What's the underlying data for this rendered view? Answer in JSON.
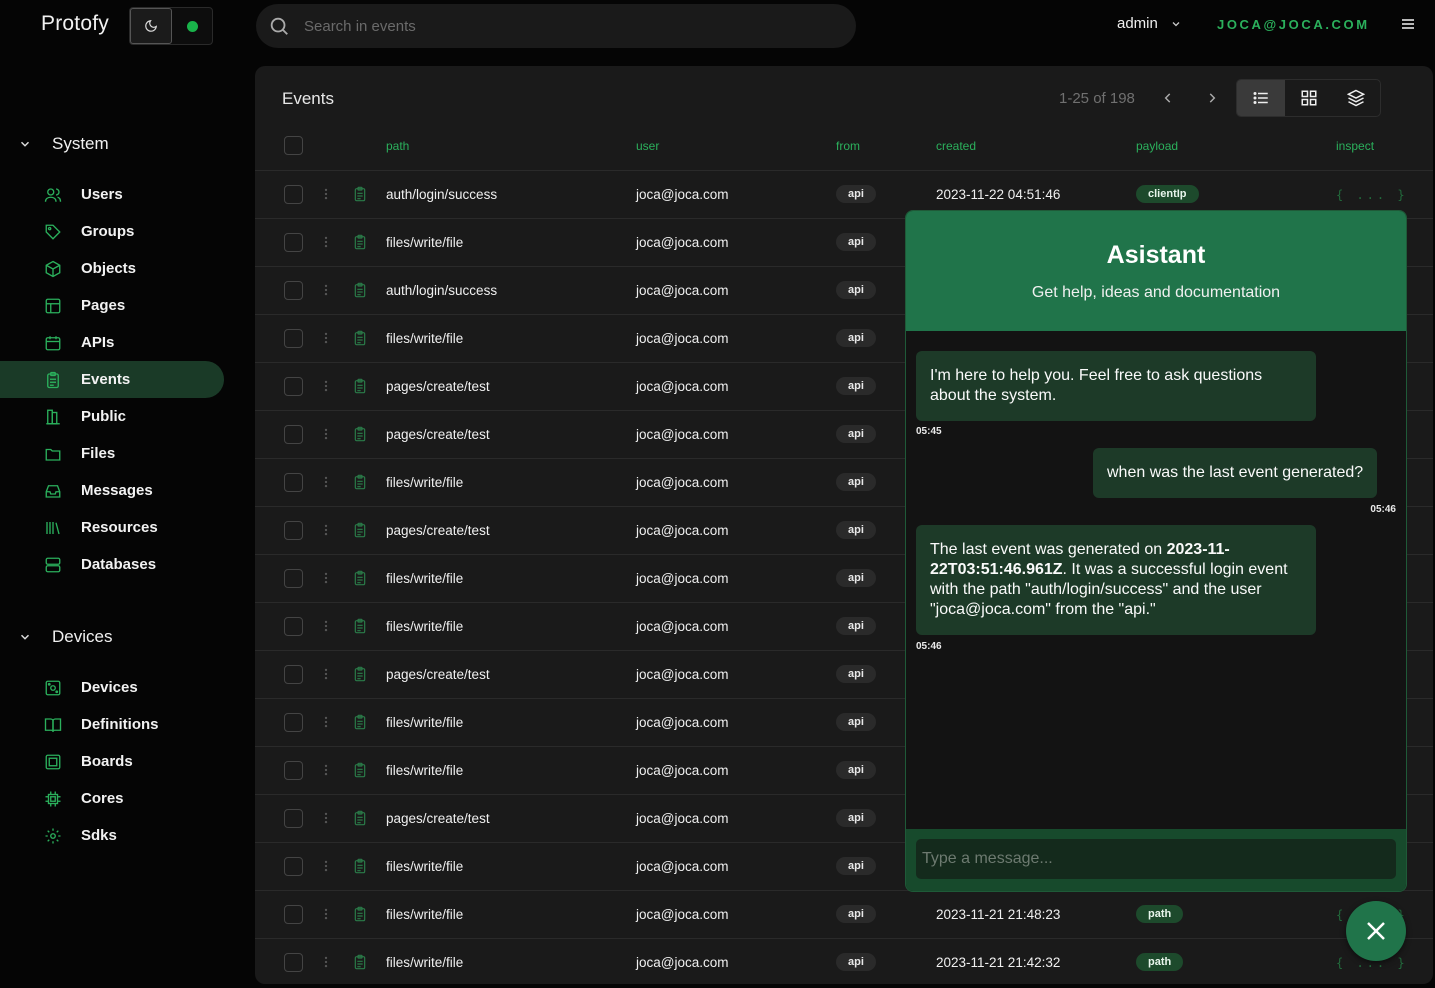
{
  "app": {
    "title": "Protofy"
  },
  "search": {
    "placeholder": "Search in events"
  },
  "header": {
    "user": "admin",
    "email": "JOCA@JOCA.COM"
  },
  "sidebar": {
    "sections": [
      {
        "label": "System",
        "items": [
          {
            "label": "Users",
            "icon": "users-icon"
          },
          {
            "label": "Groups",
            "icon": "tag-icon"
          },
          {
            "label": "Objects",
            "icon": "box-icon"
          },
          {
            "label": "Pages",
            "icon": "layout-icon"
          },
          {
            "label": "APIs",
            "icon": "calendar-icon"
          },
          {
            "label": "Events",
            "icon": "clipboard-icon",
            "active": true
          },
          {
            "label": "Public",
            "icon": "library-icon"
          },
          {
            "label": "Files",
            "icon": "folder-icon"
          },
          {
            "label": "Messages",
            "icon": "inbox-icon"
          },
          {
            "label": "Resources",
            "icon": "library-books-icon"
          },
          {
            "label": "Databases",
            "icon": "database-icon"
          }
        ]
      },
      {
        "label": "Devices",
        "items": [
          {
            "label": "Devices",
            "icon": "device-icon"
          },
          {
            "label": "Definitions",
            "icon": "book-open-icon"
          },
          {
            "label": "Boards",
            "icon": "board-icon"
          },
          {
            "label": "Cores",
            "icon": "cpu-icon"
          },
          {
            "label": "Sdks",
            "icon": "cog-icon"
          }
        ]
      }
    ]
  },
  "events": {
    "title": "Events",
    "pagination": "1-25 of 198",
    "columns": {
      "path": "path",
      "user": "user",
      "from": "from",
      "created": "created",
      "payload": "payload",
      "inspect": "inspect"
    },
    "inspect_label": "{ ... }",
    "rows": [
      {
        "path": "auth/login/success",
        "user": "joca@joca.com",
        "from": "api",
        "created": "2023-11-22 04:51:46",
        "payload": "clientIp"
      },
      {
        "path": "files/write/file",
        "user": "joca@joca.com",
        "from": "api",
        "created": "",
        "payload": ""
      },
      {
        "path": "auth/login/success",
        "user": "joca@joca.com",
        "from": "api",
        "created": "",
        "payload": ""
      },
      {
        "path": "files/write/file",
        "user": "joca@joca.com",
        "from": "api",
        "created": "",
        "payload": ""
      },
      {
        "path": "pages/create/test",
        "user": "joca@joca.com",
        "from": "api",
        "created": "",
        "payload": ""
      },
      {
        "path": "pages/create/test",
        "user": "joca@joca.com",
        "from": "api",
        "created": "",
        "payload": ""
      },
      {
        "path": "files/write/file",
        "user": "joca@joca.com",
        "from": "api",
        "created": "",
        "payload": ""
      },
      {
        "path": "pages/create/test",
        "user": "joca@joca.com",
        "from": "api",
        "created": "",
        "payload": ""
      },
      {
        "path": "files/write/file",
        "user": "joca@joca.com",
        "from": "api",
        "created": "",
        "payload": ""
      },
      {
        "path": "files/write/file",
        "user": "joca@joca.com",
        "from": "api",
        "created": "",
        "payload": ""
      },
      {
        "path": "pages/create/test",
        "user": "joca@joca.com",
        "from": "api",
        "created": "",
        "payload": ""
      },
      {
        "path": "files/write/file",
        "user": "joca@joca.com",
        "from": "api",
        "created": "",
        "payload": ""
      },
      {
        "path": "files/write/file",
        "user": "joca@joca.com",
        "from": "api",
        "created": "",
        "payload": ""
      },
      {
        "path": "pages/create/test",
        "user": "joca@joca.com",
        "from": "api",
        "created": "",
        "payload": ""
      },
      {
        "path": "files/write/file",
        "user": "joca@joca.com",
        "from": "api",
        "created": "",
        "payload": ""
      },
      {
        "path": "files/write/file",
        "user": "joca@joca.com",
        "from": "api",
        "created": "2023-11-21 21:48:23",
        "payload": "path"
      },
      {
        "path": "files/write/file",
        "user": "joca@joca.com",
        "from": "api",
        "created": "2023-11-21 21:42:32",
        "payload": "path"
      }
    ]
  },
  "assistant": {
    "title": "Asistant",
    "subtitle": "Get help, ideas and documentation",
    "messages": [
      {
        "role": "bot",
        "text_parts": [
          {
            "t": "I'm here to help you. Feel free to ask questions about the system.",
            "b": false
          }
        ],
        "time": "05:45"
      },
      {
        "role": "user",
        "text_parts": [
          {
            "t": "when was the last event generated?",
            "b": false
          }
        ],
        "time": "05:46"
      },
      {
        "role": "bot",
        "text_parts": [
          {
            "t": "The last event was generated on ",
            "b": false
          },
          {
            "t": "2023-11-22T03:51:46.961Z",
            "b": true
          },
          {
            "t": ". It was a successful login event with the path \"auth/login/success\" and the user \"joca@joca.com\" from the \"api.\"",
            "b": false
          }
        ],
        "time": "05:46"
      }
    ],
    "input_placeholder": "Type a message..."
  },
  "colors": {
    "accent": "#2bb05c",
    "assistant_header": "#20744a",
    "bubble": "#1d3a28",
    "status": "#19b34a"
  }
}
